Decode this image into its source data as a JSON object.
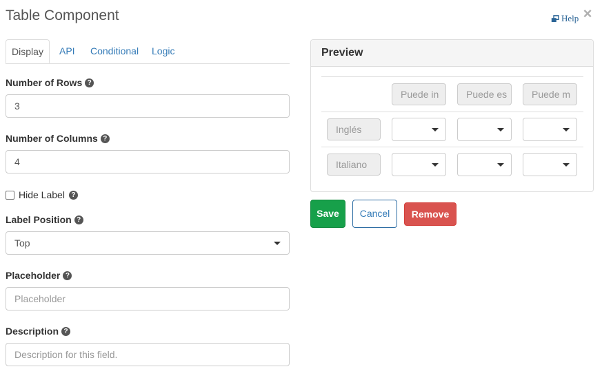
{
  "dialog": {
    "title": "Table Component",
    "help_label": "Help",
    "close_symbol": "×"
  },
  "tabs": [
    {
      "label": "Display",
      "active": true
    },
    {
      "label": "API",
      "active": false
    },
    {
      "label": "Conditional",
      "active": false
    },
    {
      "label": "Logic",
      "active": false
    }
  ],
  "form": {
    "rows": {
      "label": "Number of Rows",
      "value": "3"
    },
    "columns": {
      "label": "Number of Columns",
      "value": "4"
    },
    "hide_label": {
      "label": "Hide Label",
      "checked": false
    },
    "label_position": {
      "label": "Label Position",
      "value": "Top"
    },
    "placeholder": {
      "label": "Placeholder",
      "placeholder": "Placeholder"
    },
    "description": {
      "label": "Description",
      "placeholder": "Description for this field."
    }
  },
  "preview": {
    "title": "Preview",
    "header_cells": [
      "Puede in",
      "Puede es",
      "Puede m"
    ],
    "rows": [
      {
        "label": "Inglés"
      },
      {
        "label": "Italiano"
      }
    ]
  },
  "buttons": {
    "save": "Save",
    "cancel": "Cancel",
    "remove": "Remove"
  },
  "colors": {
    "save": "#17a04a",
    "remove": "#d9534f",
    "link": "#337ab7"
  },
  "icons": {
    "help": "external-window-icon",
    "close": "close-icon",
    "question": "question-circle-icon",
    "caret": "caret-down-icon"
  }
}
